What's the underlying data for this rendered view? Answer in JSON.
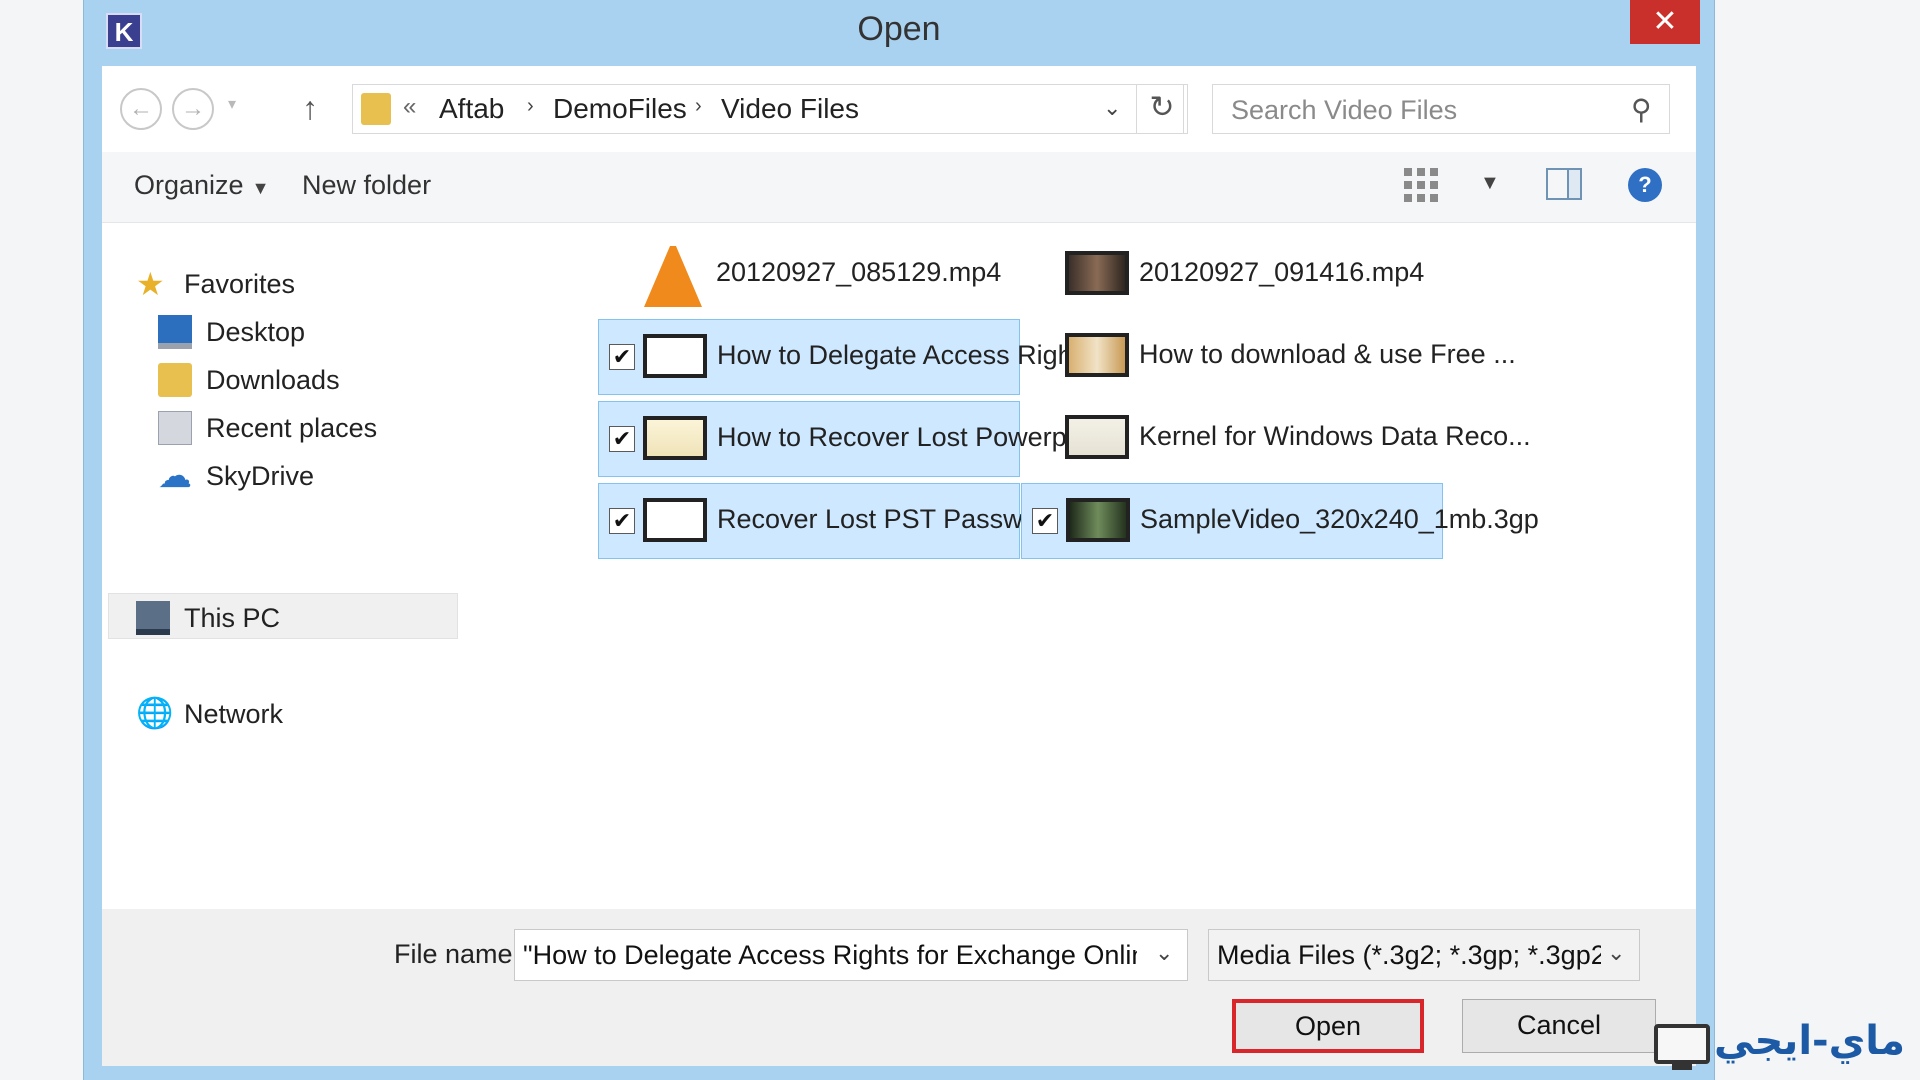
{
  "window": {
    "title": "Open",
    "app_icon_letter": "K",
    "close_glyph": "✕"
  },
  "nav": {
    "back_glyph": "←",
    "forward_glyph": "→",
    "recent_glyph": "▾",
    "up_glyph": "↑",
    "breadcrumb_prefix": "«",
    "breadcrumb": [
      "Aftab",
      "DemoFiles",
      "Video Files"
    ],
    "crumb_sep": "›",
    "address_dropdown_glyph": "⌄",
    "refresh_glyph": "↻",
    "search_placeholder": "Search Video Files",
    "search_glyph": "⚲"
  },
  "toolbar": {
    "organize_label": "Organize",
    "caret": "▼",
    "new_folder_label": "New folder",
    "view_caret": "▼",
    "help_glyph": "?"
  },
  "sidebar": {
    "items": [
      {
        "label": "Favorites",
        "icon": "star-icon",
        "glyph": "★"
      },
      {
        "label": "Desktop",
        "icon": "desktop-icon"
      },
      {
        "label": "Downloads",
        "icon": "downloads-folder-icon"
      },
      {
        "label": "Recent places",
        "icon": "recent-places-icon"
      },
      {
        "label": "SkyDrive",
        "icon": "cloud-icon",
        "glyph": "☁"
      },
      {
        "label": "This PC",
        "icon": "computer-icon"
      },
      {
        "label": "Network",
        "icon": "network-globe-icon",
        "glyph": "🌐"
      }
    ]
  },
  "files": [
    {
      "name": "20120927_085129.mp4",
      "selected": false,
      "checked": false,
      "thumb": "vlc-cone-icon"
    },
    {
      "name": "20120927_091416.mp4",
      "selected": false,
      "checked": false,
      "thumb": "video-thumbnail"
    },
    {
      "name": "How to Delegate Access Rights...",
      "selected": true,
      "checked": true,
      "thumb": "video-thumbnail"
    },
    {
      "name": "How to download & use Free ...",
      "selected": false,
      "checked": false,
      "thumb": "video-thumbnail"
    },
    {
      "name": "How to Recover Lost Powerpoi...",
      "selected": true,
      "checked": true,
      "thumb": "video-thumbnail"
    },
    {
      "name": "Kernel for Windows Data Reco...",
      "selected": false,
      "checked": false,
      "thumb": "video-thumbnail"
    },
    {
      "name": "Recover Lost PST Password wit...",
      "selected": true,
      "checked": true,
      "thumb": "video-thumbnail"
    },
    {
      "name": "SampleVideo_320x240_1mb.3gp",
      "selected": true,
      "checked": true,
      "thumb": "video-thumbnail"
    }
  ],
  "check_glyph": "✔",
  "footer": {
    "file_name_label": "File name:",
    "file_name_value": "\"How to Delegate Access Rights for Exchange Online",
    "dropdown_glyph": "⌄",
    "file_type_value": "Media Files (*.3g2; *.3gp; *.3gp2",
    "open_label": "Open",
    "cancel_label": "Cancel"
  },
  "watermark": {
    "text": "ماي-ايجي"
  },
  "colors": {
    "title_bar": "#a9d1f0",
    "close_button": "#c9302c",
    "selection_fill": "#cde8ff",
    "selection_border": "#84c3f0",
    "open_button_highlight": "#d9262b"
  }
}
